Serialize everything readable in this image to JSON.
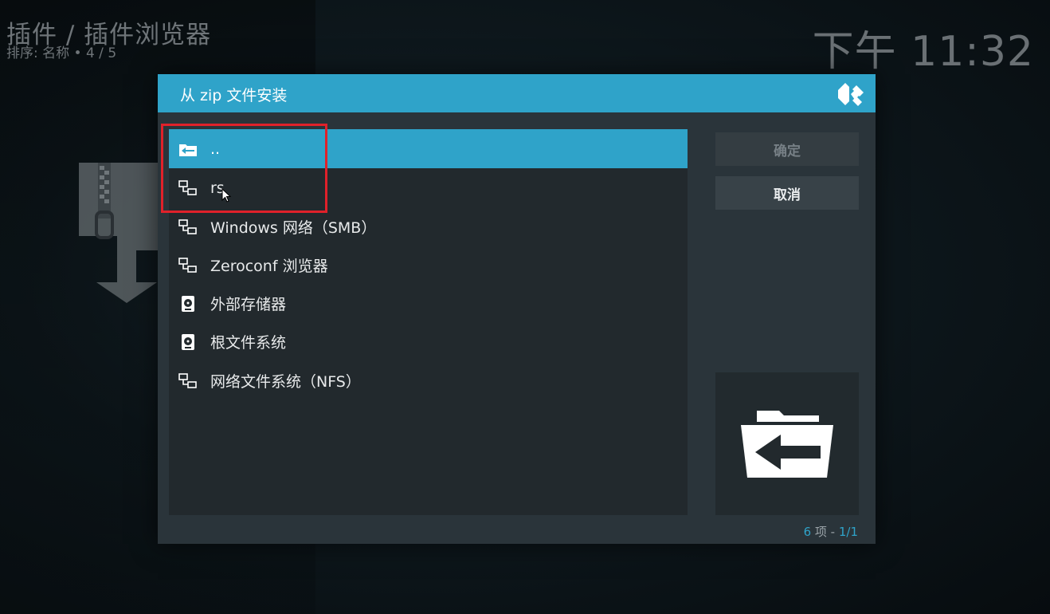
{
  "header": {
    "breadcrumb": "插件 / 插件浏览器",
    "sort_info": "排序: 名称  •  4 / 5"
  },
  "clock": "下午 11:32",
  "dialog": {
    "title": "从 zip 文件安装",
    "items": [
      {
        "label": "..",
        "icon": "folder-back-icon",
        "selected": true
      },
      {
        "label": "rs",
        "icon": "network-icon"
      },
      {
        "label": "Windows 网络（SMB）",
        "icon": "network-icon"
      },
      {
        "label": "Zeroconf 浏览器",
        "icon": "network-icon"
      },
      {
        "label": "外部存储器",
        "icon": "harddisk-icon"
      },
      {
        "label": "根文件系统",
        "icon": "harddisk-icon"
      },
      {
        "label": "网络文件系统（NFS）",
        "icon": "network-icon"
      }
    ],
    "ok_button": "确定",
    "cancel_button": "取消",
    "count_num": "6",
    "count_text": " 项 - ",
    "count_page": "1/1"
  },
  "colors": {
    "accent": "#2fa3c9",
    "highlight": "#e0212a"
  }
}
